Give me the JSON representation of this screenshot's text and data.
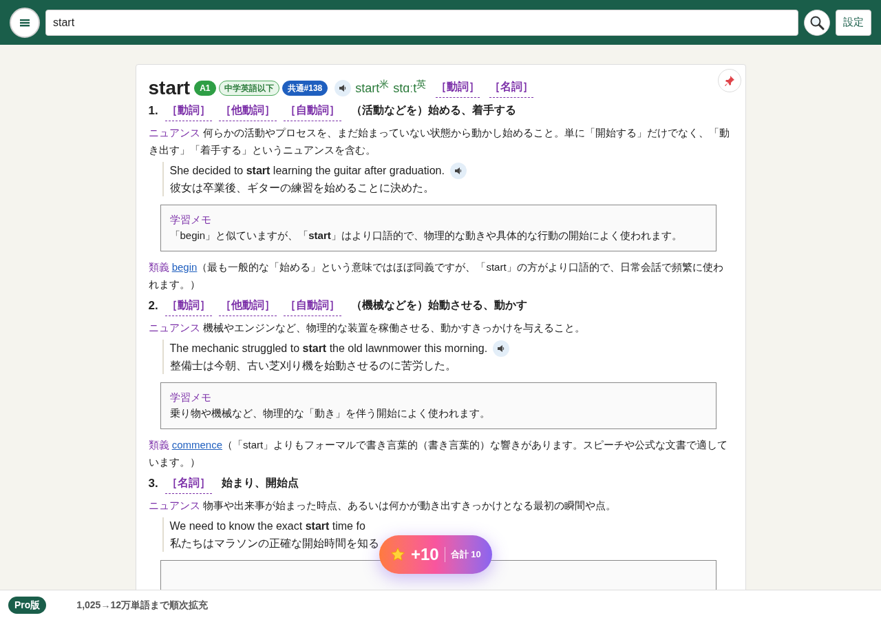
{
  "header": {
    "search_value": "start",
    "settings_button": "設定"
  },
  "entry": {
    "headword": "start",
    "badges": [
      {
        "text": "A1",
        "kind": "level"
      },
      {
        "text": "中学英語以下",
        "kind": "outline"
      },
      {
        "text": "共通#138",
        "kind": "rank"
      }
    ],
    "pronunciations": [
      "start$^{米}$",
      "stɑːt$^{英}$"
    ],
    "pos_tags": [
      "［動詞］",
      "［名詞］"
    ]
  },
  "senses": [
    {
      "number": "1.",
      "tags": [
        "［動詞］",
        "［他動詞］",
        "［自動詞］"
      ],
      "definition": "（活動などを）始める、着手する",
      "nuance_label": "ニュアンス",
      "nuance": "何らかの活動やプロセスを、まだ始まっていない状態から動かし始めること。単に「開始する」だけでなく、「動き出す」「着手する」というニュアンスを含む。",
      "example": {
        "en": "She decided to **start** learning the guitar after graduation.",
        "ja": "彼女は卒業後、ギターの練習を始めることに決めた。",
        "audio": true
      },
      "memo": {
        "label": "学習メモ",
        "text": "「begin」と似ていますが、「**start**」はより口語的で、物理的な動きや具体的な行動の開始によく使われます。"
      },
      "synonym": {
        "label": "類義",
        "word": "begin",
        "note": "（最も一般的な「始める」という意味ではほぼ同義ですが、「start」の方がより口語的で、日常会話で頻繁に使われます。）"
      }
    },
    {
      "number": "2.",
      "tags": [
        "［動詞］",
        "［他動詞］",
        "［自動詞］"
      ],
      "definition": "（機械などを）始動させる、動かす",
      "nuance_label": "ニュアンス",
      "nuance": "機械やエンジンなど、物理的な装置を稼働させる、動かすきっかけを与えること。",
      "example": {
        "en": "The mechanic struggled to **start** the old lawnmower this morning.",
        "ja": "整備士は今朝、古い芝刈り機を始動させるのに苦労した。",
        "audio": true
      },
      "memo": {
        "label": "学習メモ",
        "text": "乗り物や機械など、物理的な「動き」を伴う開始によく使われます。"
      },
      "synonym": {
        "label": "類義",
        "word": "commence",
        "note": "（「start」よりもフォーマルで書き言葉的（書き言葉的）な響きがあります。スピーチや公式な文書で適しています。）"
      }
    },
    {
      "number": "3.",
      "tags": [
        "［名詞］"
      ],
      "definition": "始まり、開始点",
      "nuance_label": "ニュアンス",
      "nuance": "物事や出来事が始まった時点、あるいは何かが動き出すきっかけとなる最初の瞬間や点。",
      "example": {
        "en": "We need to know the exact **start** time fo",
        "ja": "私たちはマラソンの正確な開始時間を知る",
        "audio": false
      },
      "memo_box": true
    }
  ],
  "toast": {
    "points": "+10",
    "total": "合計 10"
  },
  "footer": {
    "badge": "Pro版",
    "text": "1,025→12万単語まで順次拡充"
  }
}
